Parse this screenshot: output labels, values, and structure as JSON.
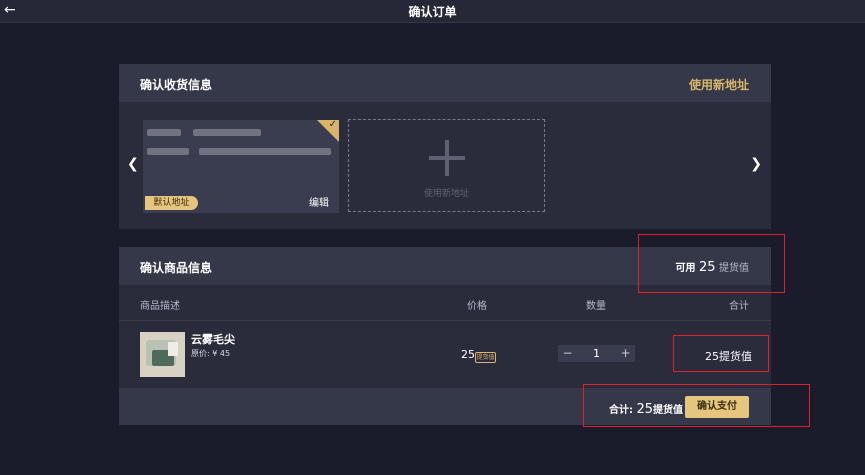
{
  "header": {
    "title": "确认订单",
    "back_icon": "arrow-left-icon"
  },
  "address_section": {
    "title": "确认收货信息",
    "new_address_link": "使用新地址",
    "card": {
      "default_badge": "默认地址",
      "edit_label": "编辑",
      "selected": true
    },
    "add_card_label": "使用新地址"
  },
  "product_section": {
    "title": "确认商品信息",
    "available": {
      "prefix": "可用",
      "amount": "25",
      "unit": "提货值"
    },
    "columns": {
      "desc": "商品描述",
      "price": "价格",
      "qty": "数量",
      "total": "合计"
    },
    "item": {
      "name": "云雾毛尖",
      "original_price": "原价: ¥ 45",
      "price": "25",
      "price_tag": "提货值",
      "quantity": "1",
      "total": "25提货值"
    },
    "footer": {
      "total_label": "合计:",
      "total_amount": "25",
      "total_unit": "提货值",
      "pay_button": "确认支付"
    }
  },
  "colors": {
    "accent": "#d9b56b",
    "background": "#1a1c2b",
    "panel": "#2a2c3c",
    "highlight": "#e0202a"
  }
}
